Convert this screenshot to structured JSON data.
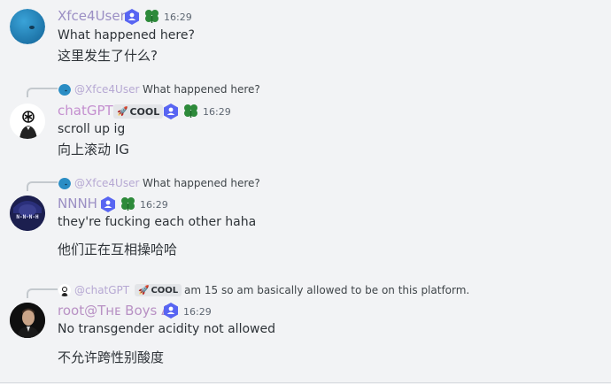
{
  "messages": [
    {
      "author": "Xfce4User",
      "author_color": "#9b8fc4",
      "time": "16:29",
      "lines": [
        "What happened here?",
        "这里发生了什么?"
      ]
    },
    {
      "reply": {
        "mention": "@Xfce4User",
        "text": "What happened here?"
      },
      "author": "chatGPT",
      "author_color": "#c48fcf",
      "role_tag": "COOL",
      "time": "16:29",
      "lines": [
        "scroll up ig",
        "向上滚动 IG"
      ]
    },
    {
      "reply": {
        "mention": "@Xfce4User",
        "text": "What happened here?"
      },
      "author": "NNNH",
      "author_color": "#9b8fc4",
      "avatar_text": "N-N-N-H",
      "time": "16:29",
      "lines": [
        "they're fucking each other haha",
        "他们正在互相操哈哈"
      ]
    },
    {
      "reply": {
        "mention": "@chatGPT",
        "role_tag": "COOL",
        "text": "am 15 so am basically allowed to be on this platform."
      },
      "author": "root@Tʜᴇ Boys Δ",
      "author_color": "#b891c4",
      "time": "16:29",
      "lines": [
        "No transgender acidity not allowed",
        "不允许跨性别酸度"
      ]
    }
  ],
  "colors": {
    "background": "#f2f3f5",
    "badge_blue": "#5865f2",
    "clover_green": "#2d8a3a"
  },
  "icons": [
    "user-badge-icon",
    "clover-icon",
    "rocket-icon",
    "reply-spine"
  ]
}
